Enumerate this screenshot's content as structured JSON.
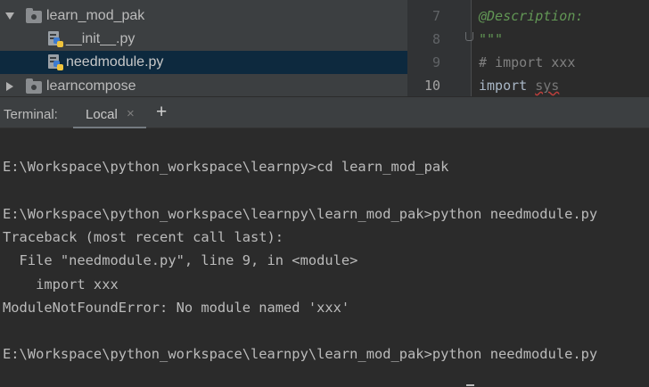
{
  "project_tree": {
    "items": [
      {
        "label": "learn_mod_pak",
        "icon": "folder-icon",
        "expanded": true
      },
      {
        "label": "__init__.py",
        "icon": "python-file-icon"
      },
      {
        "label": "needmodule.py",
        "icon": "python-file-icon",
        "selected": true
      },
      {
        "label": "learncompose",
        "icon": "folder-icon",
        "expanded": false
      }
    ]
  },
  "editor": {
    "lines": [
      {
        "number": "7",
        "text": "@Description:"
      },
      {
        "number": "8",
        "text": "\"\"\""
      },
      {
        "number": "9",
        "text": "# import xxx"
      },
      {
        "number": "10",
        "keyword": "import",
        "module": "sys"
      }
    ]
  },
  "terminal_panel": {
    "title": "Terminal:",
    "tab_label": "Local",
    "close_glyph": "×",
    "add_glyph": "+"
  },
  "terminal": {
    "lines": [
      "E:\\Workspace\\python_workspace\\learnpy>cd learn_mod_pak",
      "E:\\Workspace\\python_workspace\\learnpy\\learn_mod_pak>python needmodule.py",
      "Traceback (most recent call last):",
      "  File \"needmodule.py\", line 9, in <module>",
      "    import xxx",
      "ModuleNotFoundError: No module named 'xxx'",
      "E:\\Workspace\\python_workspace\\learnpy\\learn_mod_pak>python needmodule.py"
    ]
  },
  "colors": {
    "panel_bg": "#3c3f41",
    "editor_bg": "#2b2b2b",
    "selection": "#0d293e",
    "docstring": "#629755",
    "comment": "#808080"
  }
}
